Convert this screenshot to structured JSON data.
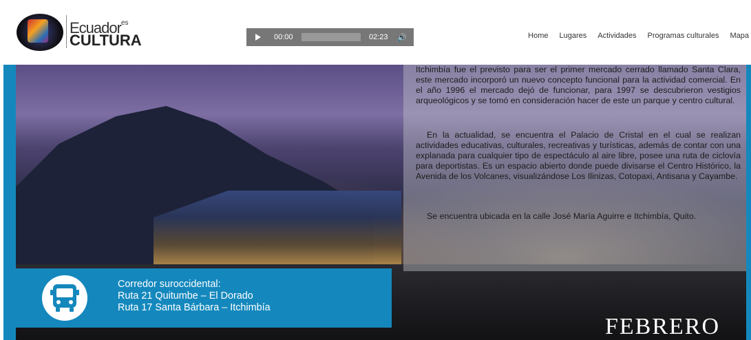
{
  "header": {
    "logo": {
      "line1": "Ecuador",
      "line1_sup": "es",
      "line2": "CULTURA"
    },
    "player": {
      "current_time": "00:00",
      "duration": "02:23",
      "progress": 0
    },
    "nav": [
      "Home",
      "Lugares",
      "Actividades",
      "Programas culturales",
      "Mapa"
    ]
  },
  "content": {
    "paragraphs": [
      "Itchimbía fue el previsto para ser el primer mercado cerrado llamado Santa Clara, este mercado incorporó un nuevo concepto funcional para la actividad comercial. En el año 1996 el mercado dejó de funcionar, para 1997 se descubrieron vestigios arqueológicos y se tomó en consideración hacer de este un parque y centro cultural.",
      "En la actualidad, se encuentra el Palacio de Cristal en el cual se realizan actividades educativas, culturales, recreativas y turísticas, además de contar con una explanada para cualquier tipo de espectáculo al aire libre, posee una ruta de ciclovía para deportistas. Es un espacio abierto donde puede divisarse el Centro Histórico, la Avenida de los Volcanes, visualizándose Los Ilinizas, Cotopaxi, Antisana y Cayambe.",
      "Se encuentra ubicada en la calle José María Aguirre e Itchimbía, Quito."
    ],
    "bus": {
      "icon": "bus-icon",
      "lines": [
        "Corredor suroccidental:",
        "Ruta 21 Quitumbe – El Dorado",
        "Ruta 17 Santa Bárbara – Itchimbía"
      ]
    },
    "month": "FEBRERO"
  },
  "colors": {
    "accent": "#1488bd",
    "player_bg": "#777777",
    "text": "#1c1c1c"
  }
}
